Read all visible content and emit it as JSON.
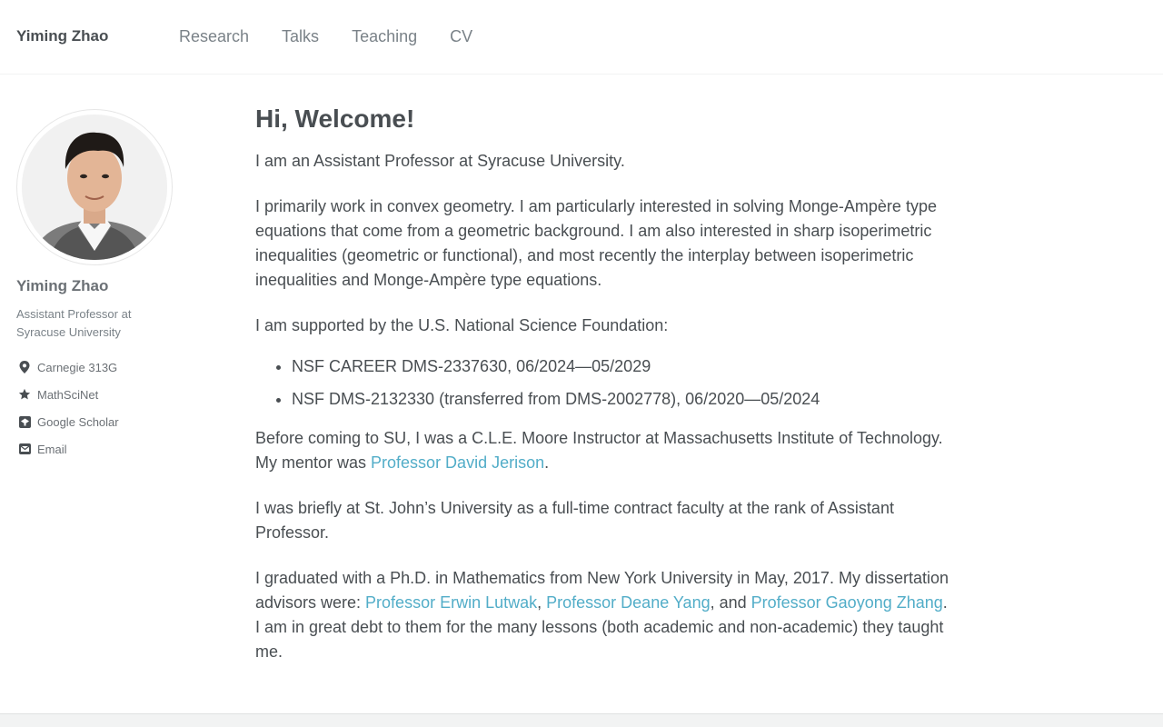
{
  "header": {
    "site_title": "Yiming Zhao",
    "nav": [
      "Research",
      "Talks",
      "Teaching",
      "CV"
    ]
  },
  "sidebar": {
    "name": "Yiming Zhao",
    "bio": "Assistant Professor at Syracuse University",
    "links": [
      {
        "icon": "location-pin-icon",
        "label": "Carnegie 313G"
      },
      {
        "icon": "star-icon",
        "label": "MathSciNet"
      },
      {
        "icon": "google-scholar-icon",
        "label": "Google Scholar"
      },
      {
        "icon": "envelope-icon",
        "label": "Email"
      }
    ]
  },
  "main": {
    "heading": "Hi, Welcome!",
    "p1": "I am an Assistant Professor at Syracuse University.",
    "p2": "I primarily work in convex geometry. I am particularly interested in solving Monge-Ampère type equations that come from a geometric background. I am also interested in sharp isoperimetric inequalities (geometric or functional), and most recently the interplay between isoperimetric inequalities and Monge-Ampère type equations.",
    "p3": "I am supported by the U.S. National Science Foundation:",
    "grants": [
      "NSF CAREER DMS-2337630, 06/2024—05/2029",
      "NSF DMS-2132330 (transferred from DMS-2002778), 06/2020—05/2024"
    ],
    "p4_text": "Before coming to SU, I was a C.L.E. Moore Instructor at Massachusetts Institute of Technology. My mentor was ",
    "p4_link": "Professor David Jerison",
    "p4_end": ".",
    "p5": "I was briefly at St. John’s University as a full-time contract faculty at the rank of Assistant Professor.",
    "p6_text": "I graduated with a Ph.D. in Mathematics from New York University in May, 2017. My dissertation advisors were: ",
    "p6_link1": "Professor Erwin Lutwak",
    "p6_sep1": ", ",
    "p6_link2": "Professor Deane Yang",
    "p6_sep2": ", and ",
    "p6_link3": "Professor Gaoyong Zhang",
    "p6_end": ". I am in great debt to them for the many lessons (both academic and non-academic) they taught me."
  },
  "colors": {
    "link": "#52adc8",
    "text": "#494e52",
    "muted": "#7a8288"
  }
}
